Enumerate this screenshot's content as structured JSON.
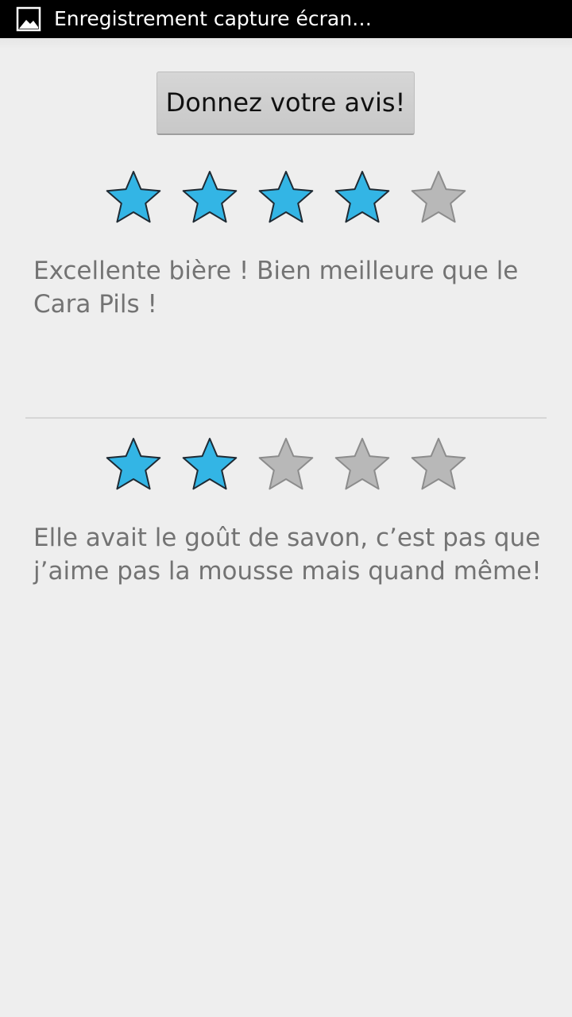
{
  "status_bar": {
    "notification_icon": "gallery-icon",
    "text": "Enregistrement capture écran…"
  },
  "header": {
    "button_label": "Donnez votre avis!"
  },
  "colors": {
    "star_filled": "#33b5e5",
    "star_empty": "#b8b8b8"
  },
  "reviews": [
    {
      "rating": 4,
      "max_rating": 5,
      "text": "Excellente bière ! Bien meilleure que le Cara Pils !"
    },
    {
      "rating": 2,
      "max_rating": 5,
      "text": "Elle avait le goût de savon, c’est pas que j’aime pas la mousse mais quand même!"
    }
  ]
}
